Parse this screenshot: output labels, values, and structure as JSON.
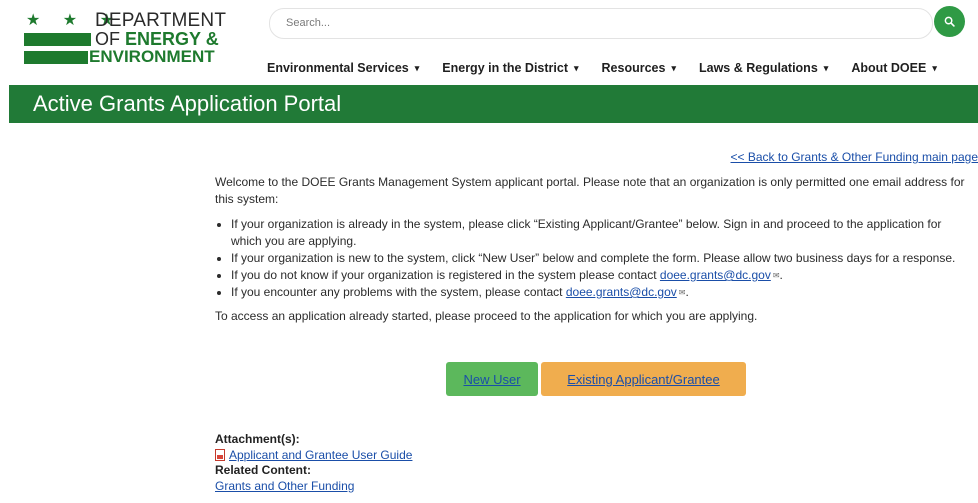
{
  "logo": {
    "stars": "★ ★ ★",
    "line1": "DEPARTMENT",
    "line2_of": "OF ",
    "line2_main": "ENERGY &",
    "line3": "ENVIRONMENT"
  },
  "search": {
    "placeholder": "Search...",
    "button_icon": "search-icon"
  },
  "nav": {
    "items": [
      {
        "label": "Environmental Services"
      },
      {
        "label": "Energy in the District"
      },
      {
        "label": "Resources"
      },
      {
        "label": "Laws & Regulations"
      },
      {
        "label": "About DOEE"
      }
    ],
    "caret": "▾"
  },
  "banner": {
    "title": "Active Grants Application Portal"
  },
  "content": {
    "back_link": "<< Back to Grants & Other Funding main page",
    "intro": "Welcome to the DOEE Grants Management System applicant portal. Please note that an organization is only permitted one email address for this system:",
    "bullets": [
      "If your organization is already in the system, please click “Existing Applicant/Grantee” below. Sign in and proceed to the application for which you are applying.",
      "If your organization is new to the system, click “New User” below and complete the form. Please allow two business days for a response.",
      "If you do not know if your organization is registered in the system please contact ",
      "If you encounter any problems with the system, please contact "
    ],
    "email": "doee.grants@dc.gov",
    "ext_icon": "✉",
    "access_note": "To access an application already started, please proceed to the application for which you are applying."
  },
  "buttons": {
    "new_user": "New User",
    "existing": "Existing Applicant/Grantee"
  },
  "attachments": {
    "heading": "Attachment(s):",
    "file_label": "Applicant and Grantee User Guide",
    "related_heading": "Related Content:",
    "related_link": "Grants and Other Funding"
  },
  "colors": {
    "brand_green": "#217a37",
    "new_user_bg": "#5cb85c",
    "existing_bg": "#f0ad4e",
    "link": "#1a4ea8"
  }
}
